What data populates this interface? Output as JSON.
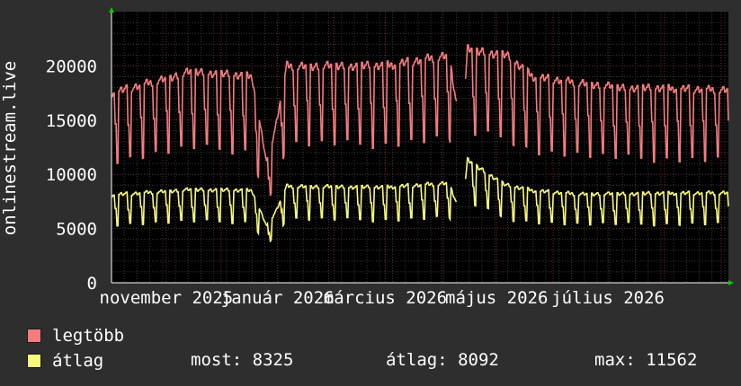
{
  "chart_data": {
    "type": "line",
    "ylabel": "onlinestream.live",
    "ylim": [
      0,
      25000
    ],
    "yticks": [
      0,
      5000,
      10000,
      15000,
      20000
    ],
    "ytick_labels": [
      "0",
      "5000",
      "10000",
      "15000",
      "20000"
    ],
    "xlim": [
      "2025-10-02",
      "2026-09-05"
    ],
    "xtick_labels": [
      "november 2025",
      "január 2026",
      "március 2026",
      "május 2026",
      "július 2026"
    ],
    "xtick_dates": [
      "2025-11-01",
      "2026-01-01",
      "2026-03-01",
      "2026-05-01",
      "2026-07-01"
    ],
    "grid": true,
    "legend_position": "bottom-left",
    "series": [
      {
        "name": "legtöbb",
        "color": "#f47c7c",
        "keypoints": [
          {
            "x": "2025-10-02",
            "y": 17500
          },
          {
            "x": "2025-11-15",
            "y": 19500
          },
          {
            "x": "2025-12-18",
            "y": 19000
          },
          {
            "x": "2025-12-26",
            "y": 11000
          },
          {
            "x": "2025-12-31",
            "y": 14500
          },
          {
            "x": "2026-01-06",
            "y": 20000
          },
          {
            "x": "2026-03-01",
            "y": 20000
          },
          {
            "x": "2026-04-05",
            "y": 21000
          },
          {
            "x": "2026-04-12",
            "y": 13200
          },
          {
            "x": "2026-04-15",
            "y": 21500
          },
          {
            "x": "2026-05-06",
            "y": 21000
          },
          {
            "x": "2026-05-21",
            "y": 19000
          },
          {
            "x": "2026-06-13",
            "y": 18500
          },
          {
            "x": "2026-07-08",
            "y": 18000
          },
          {
            "x": "2026-09-04",
            "y": 17800
          }
        ]
      },
      {
        "name": "átlag",
        "color": "#f9f97e",
        "keypoints": [
          {
            "x": "2025-10-02",
            "y": 8100
          },
          {
            "x": "2025-11-15",
            "y": 8600
          },
          {
            "x": "2025-12-18",
            "y": 8500
          },
          {
            "x": "2025-12-26",
            "y": 5200
          },
          {
            "x": "2025-12-31",
            "y": 6600
          },
          {
            "x": "2026-01-06",
            "y": 8900
          },
          {
            "x": "2026-03-01",
            "y": 8800
          },
          {
            "x": "2026-04-05",
            "y": 9200
          },
          {
            "x": "2026-04-12",
            "y": 6000
          },
          {
            "x": "2026-04-15",
            "y": 11300
          },
          {
            "x": "2026-05-06",
            "y": 9000
          },
          {
            "x": "2026-05-21",
            "y": 8500
          },
          {
            "x": "2026-06-13",
            "y": 8200
          },
          {
            "x": "2026-07-08",
            "y": 8200
          },
          {
            "x": "2026-09-04",
            "y": 8300
          }
        ]
      }
    ]
  },
  "legend": {
    "items": [
      {
        "label": "legtöbb",
        "color": "#f47c7c"
      },
      {
        "label": "átlag",
        "color": "#f9f97e"
      }
    ]
  },
  "stats": {
    "current": "most: 8325",
    "average": "átlag: 8092",
    "max": "max: 11562"
  }
}
